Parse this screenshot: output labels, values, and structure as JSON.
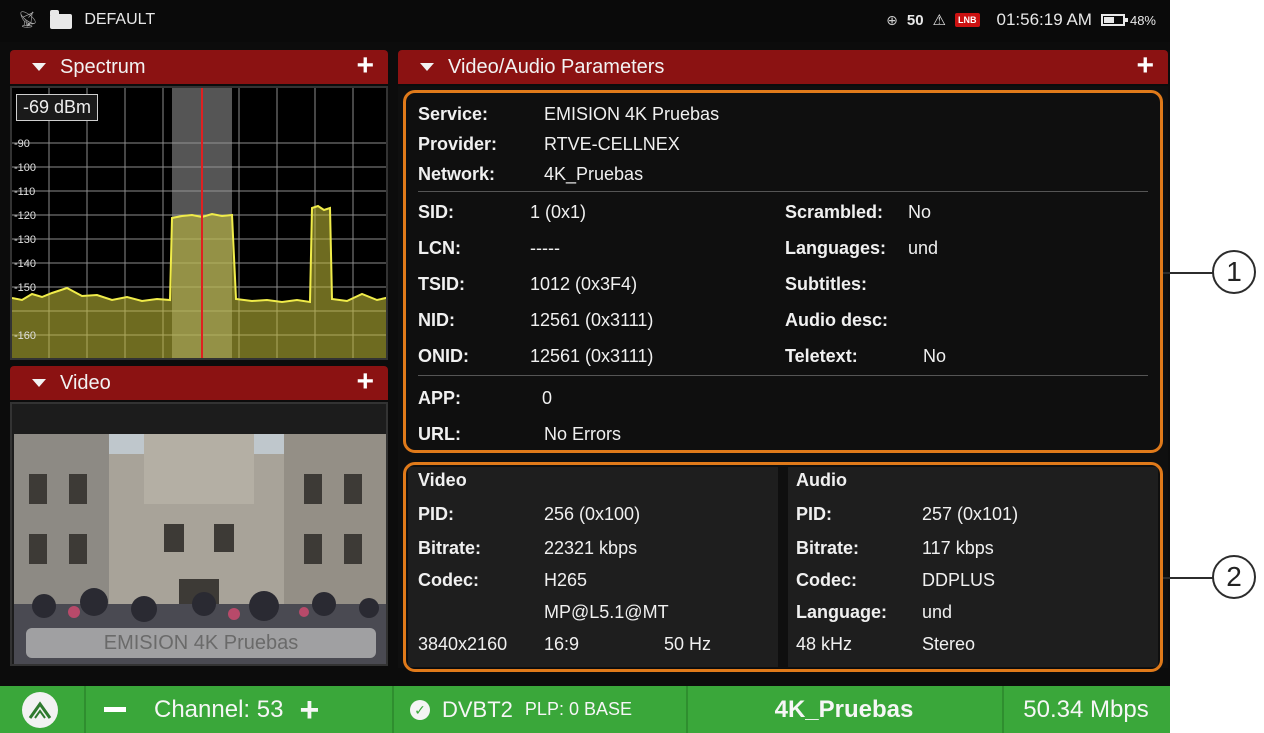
{
  "status_bar": {
    "profile": "DEFAULT",
    "signal_level": "50",
    "lock_badge": "LNB",
    "time": "01:56:19 AM",
    "battery": "48%"
  },
  "spectrum": {
    "title": "Spectrum",
    "level": "-69 dBm",
    "y_ticks": [
      "-90",
      "-100",
      "-110",
      "-120",
      "-130",
      "-140",
      "-150",
      "-160"
    ]
  },
  "video": {
    "title": "Video",
    "caption": "EMISION 4K Pruebas"
  },
  "params": {
    "title": "Video/Audio Parameters",
    "service_label": "Service:",
    "service": "EMISION 4K Pruebas",
    "provider_label": "Provider:",
    "provider": "RTVE-CELLNEX",
    "network_label": "Network:",
    "network": "4K_Pruebas",
    "sid_label": "SID:",
    "sid": "1 (0x1)",
    "lcn_label": "LCN:",
    "lcn": "-----",
    "tsid_label": "TSID:",
    "tsid": "1012 (0x3F4)",
    "nid_label": "NID:",
    "nid": "12561 (0x3111)",
    "onid_label": "ONID:",
    "onid": "12561 (0x3111)",
    "scrambled_label": "Scrambled:",
    "scrambled": "No",
    "languages_label": "Languages:",
    "languages": "und",
    "subtitles_label": "Subtitles:",
    "audio_desc_label": "Audio desc:",
    "teletext_label": "Teletext:",
    "teletext": "No",
    "app_label": "APP:",
    "app": "0",
    "url_label": "URL:",
    "url": "No Errors"
  },
  "video_params": {
    "heading": "Video",
    "pid_label": "PID:",
    "pid": "256 (0x100)",
    "bitrate_label": "Bitrate:",
    "bitrate": "22321 kbps",
    "codec_label": "Codec:",
    "codec": "H265",
    "profile": "MP@L5.1@MT",
    "resolution": "3840x2160",
    "aspect": "16:9",
    "framerate": "50 Hz"
  },
  "audio_params": {
    "heading": "Audio",
    "pid_label": "PID:",
    "pid": "257 (0x101)",
    "bitrate_label": "Bitrate:",
    "bitrate": "117 kbps",
    "codec_label": "Codec:",
    "codec": "DDPLUS",
    "language_label": "Language:",
    "language": "und",
    "samplerate": "48 kHz",
    "mode": "Stereo"
  },
  "callouts": {
    "c1": "1",
    "c2": "2"
  },
  "bottom_bar": {
    "channel": "Channel: 53",
    "standard": "DVBT2",
    "plp": "PLP: 0 BASE",
    "network": "4K_Pruebas",
    "bitrate": "50.34 Mbps"
  },
  "colors": {
    "header": "#8b1212",
    "highlight": "#e07a1a",
    "bottom_bar": "#3aa73a"
  }
}
